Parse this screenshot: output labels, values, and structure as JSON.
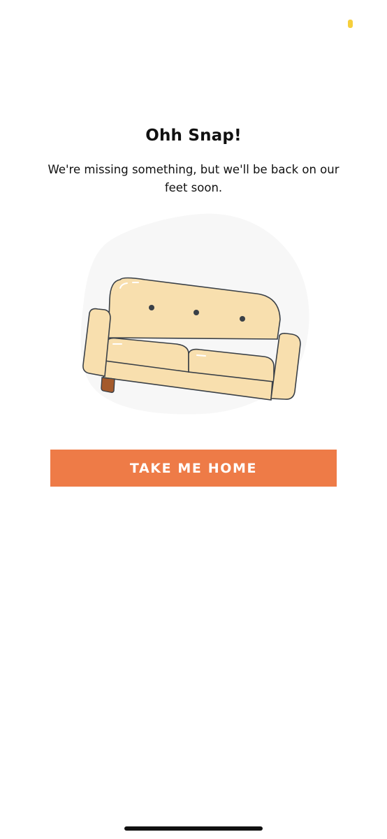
{
  "status_bar": {
    "indicator_color": "#f6cf3c"
  },
  "error": {
    "title": "Ohh Snap!",
    "message": "We're missing something, but we'll be back on our feet soon."
  },
  "illustration": {
    "name": "broken-couch-illustration",
    "colors": {
      "blob": "#f7f7f7",
      "couch": "#f8dfae",
      "outline": "#3a4047",
      "leg": "#a45a2c"
    }
  },
  "actions": {
    "home_button_label": "TAKE ME HOME",
    "home_button_color": "#ee7b47"
  }
}
